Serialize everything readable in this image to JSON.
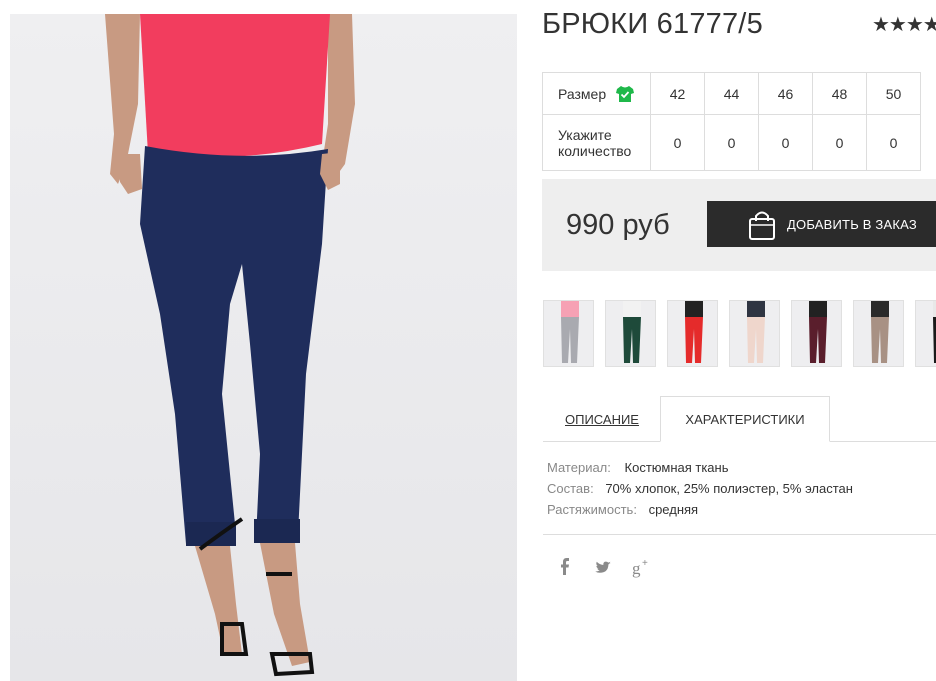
{
  "product": {
    "title": "БРЮКИ 61777/5",
    "rating_stars": "★★★★"
  },
  "size_table": {
    "size_label": "Размер",
    "qty_label_1": "Укажите",
    "qty_label_2": "количество",
    "sizes": [
      "42",
      "44",
      "46",
      "48",
      "50"
    ],
    "quantities": [
      "0",
      "0",
      "0",
      "0",
      "0"
    ]
  },
  "purchase": {
    "price": "990 руб",
    "order_button": "ДОБАВИТЬ В ЗАКАЗ"
  },
  "color_variants": [
    "gray",
    "dark-green",
    "red",
    "beige",
    "burgundy",
    "taupe",
    "black"
  ],
  "tabs": {
    "description": "ОПИСАНИЕ",
    "characteristics": "ХАРАКТЕРИСТИКИ"
  },
  "specs": [
    {
      "key": "Материал:",
      "value": "Костюмная ткань"
    },
    {
      "key": "Состав:",
      "value": "70% хлопок, 25% полиэстер, 5% эластан"
    },
    {
      "key": "Растяжимость:",
      "value": "средняя"
    }
  ],
  "social": {
    "facebook": "f",
    "twitter": "twitter-bird",
    "google_plus": "g+"
  },
  "colors": {
    "accent_green": "#1fb84a",
    "button_dark": "#2b2b2b",
    "price_bg": "#eeeeee"
  }
}
